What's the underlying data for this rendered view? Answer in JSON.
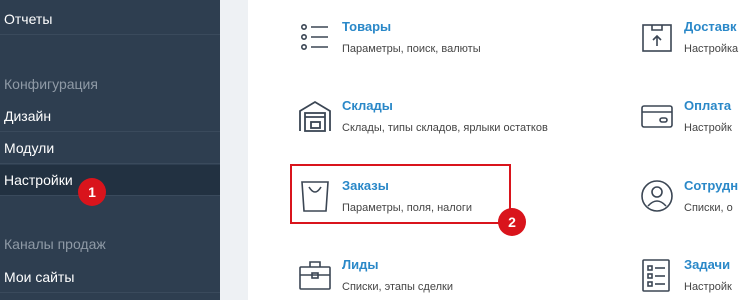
{
  "sidebar": {
    "reports": "Отчеты",
    "section_config": "Конфигурация",
    "design": "Дизайн",
    "modules": "Модули",
    "settings": "Настройки",
    "section_channels": "Каналы продаж",
    "my_sites": "Мои сайты"
  },
  "tiles": {
    "products": {
      "title": "Товары",
      "subtitle": "Параметры, поиск, валюты",
      "icon": "list-icon"
    },
    "delivery": {
      "title": "Доставк",
      "subtitle": "Настройка",
      "icon": "box-icon"
    },
    "warehouses": {
      "title": "Склады",
      "subtitle": "Склады, типы складов, ярлыки остатков",
      "icon": "warehouse-icon"
    },
    "payment": {
      "title": "Оплата",
      "subtitle": "Настройк",
      "icon": "card-icon"
    },
    "orders": {
      "title": "Заказы",
      "subtitle": "Параметры, поля, налоги",
      "icon": "bag-icon"
    },
    "employees": {
      "title": "Сотрудн",
      "subtitle": "Списки, о",
      "icon": "user-icon"
    },
    "leads": {
      "title": "Лиды",
      "subtitle": "Списки, этапы сделки",
      "icon": "briefcase-icon"
    },
    "tasks": {
      "title": "Задачи",
      "subtitle": "Настройк",
      "icon": "checklist-icon"
    }
  },
  "annotations": {
    "badge_1": "1",
    "badge_2": "2"
  },
  "colors": {
    "sidebar_bg": "#2e3e50",
    "link_blue": "#2a88c8",
    "annotation_red": "#d9141c"
  }
}
